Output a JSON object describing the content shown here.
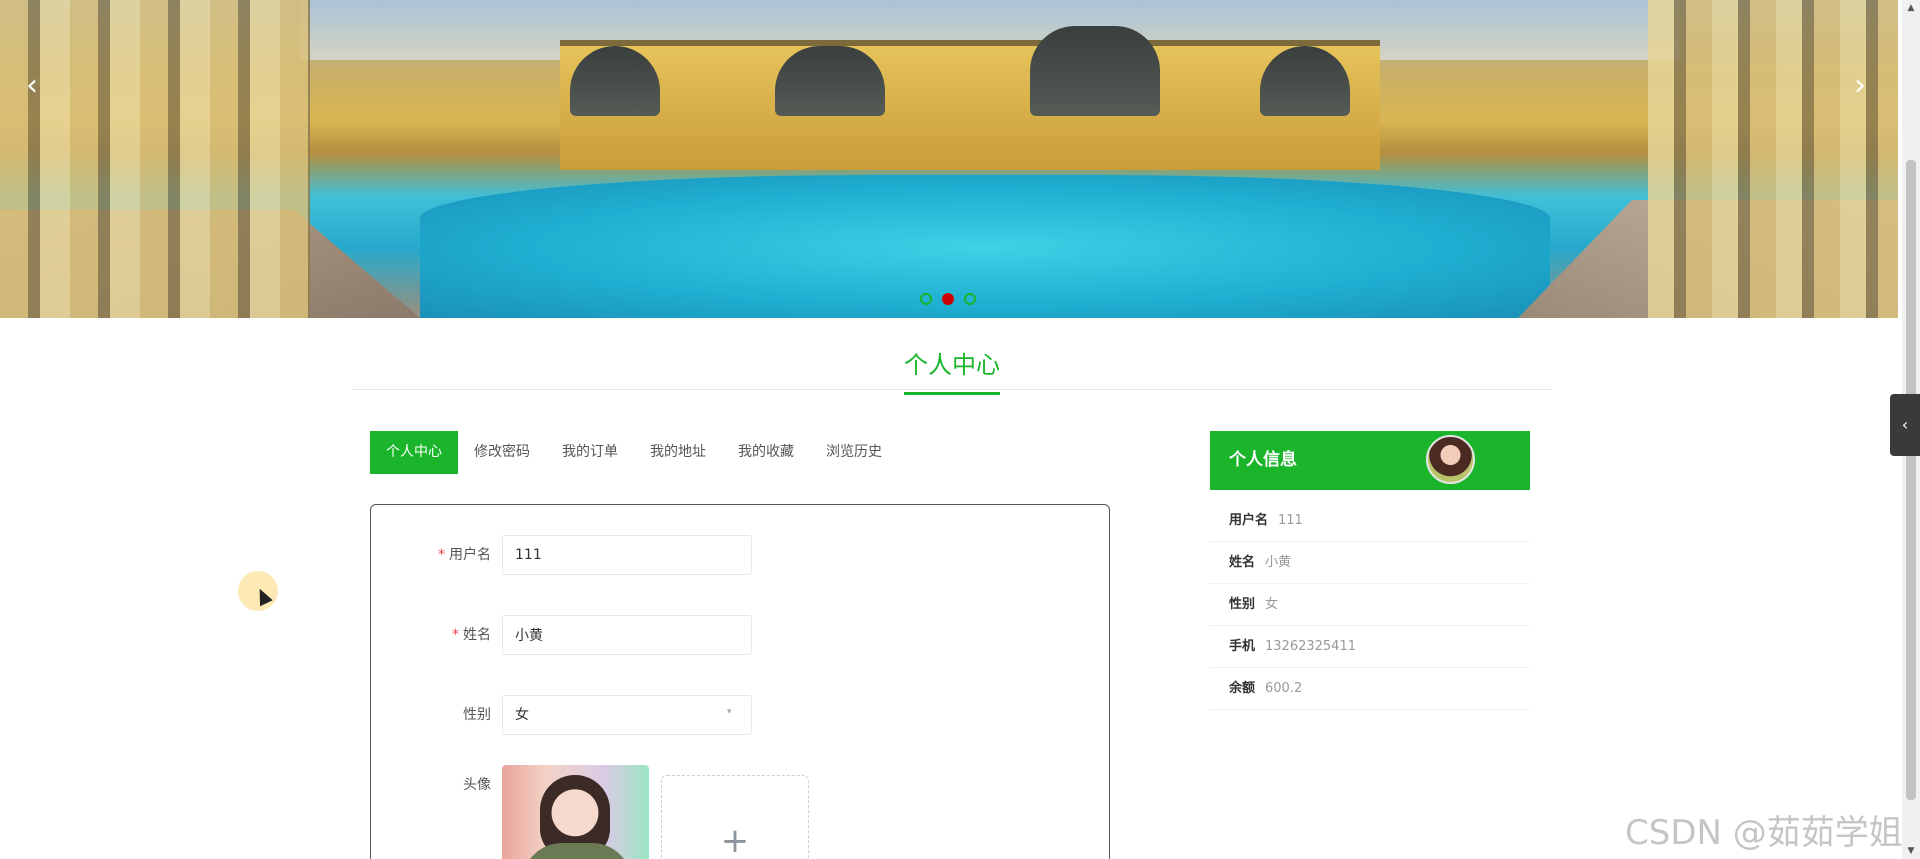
{
  "banner": {
    "prev_arrow": "‹",
    "next_arrow": "›",
    "slide_count": 3,
    "active_slide": 2
  },
  "section_title": "个人中心",
  "tabs": [
    {
      "label": "个人中心",
      "active": true
    },
    {
      "label": "修改密码",
      "active": false
    },
    {
      "label": "我的订单",
      "active": false
    },
    {
      "label": "我的地址",
      "active": false
    },
    {
      "label": "我的收藏",
      "active": false
    },
    {
      "label": "浏览历史",
      "active": false
    }
  ],
  "form": {
    "username": {
      "label": "用户名",
      "required": true,
      "value": "111"
    },
    "name": {
      "label": "姓名",
      "required": true,
      "value": "小黄"
    },
    "gender": {
      "label": "性别",
      "required": false,
      "value": "女"
    },
    "avatar": {
      "label": "头像",
      "upload_icon": "+"
    }
  },
  "info_panel": {
    "title": "个人信息",
    "rows": [
      {
        "key": "用户名",
        "value": "111"
      },
      {
        "key": "姓名",
        "value": "小黄"
      },
      {
        "key": "性别",
        "value": "女"
      },
      {
        "key": "手机",
        "value": "13262325411"
      },
      {
        "key": "余额",
        "value": "600.2"
      }
    ]
  },
  "side_toggle_icon": "‹",
  "watermark": "CSDN @茹茹学姐",
  "colors": {
    "accent": "#1ab52a",
    "required": "#ee4444",
    "carousel_active_dot": "#cc0000"
  }
}
